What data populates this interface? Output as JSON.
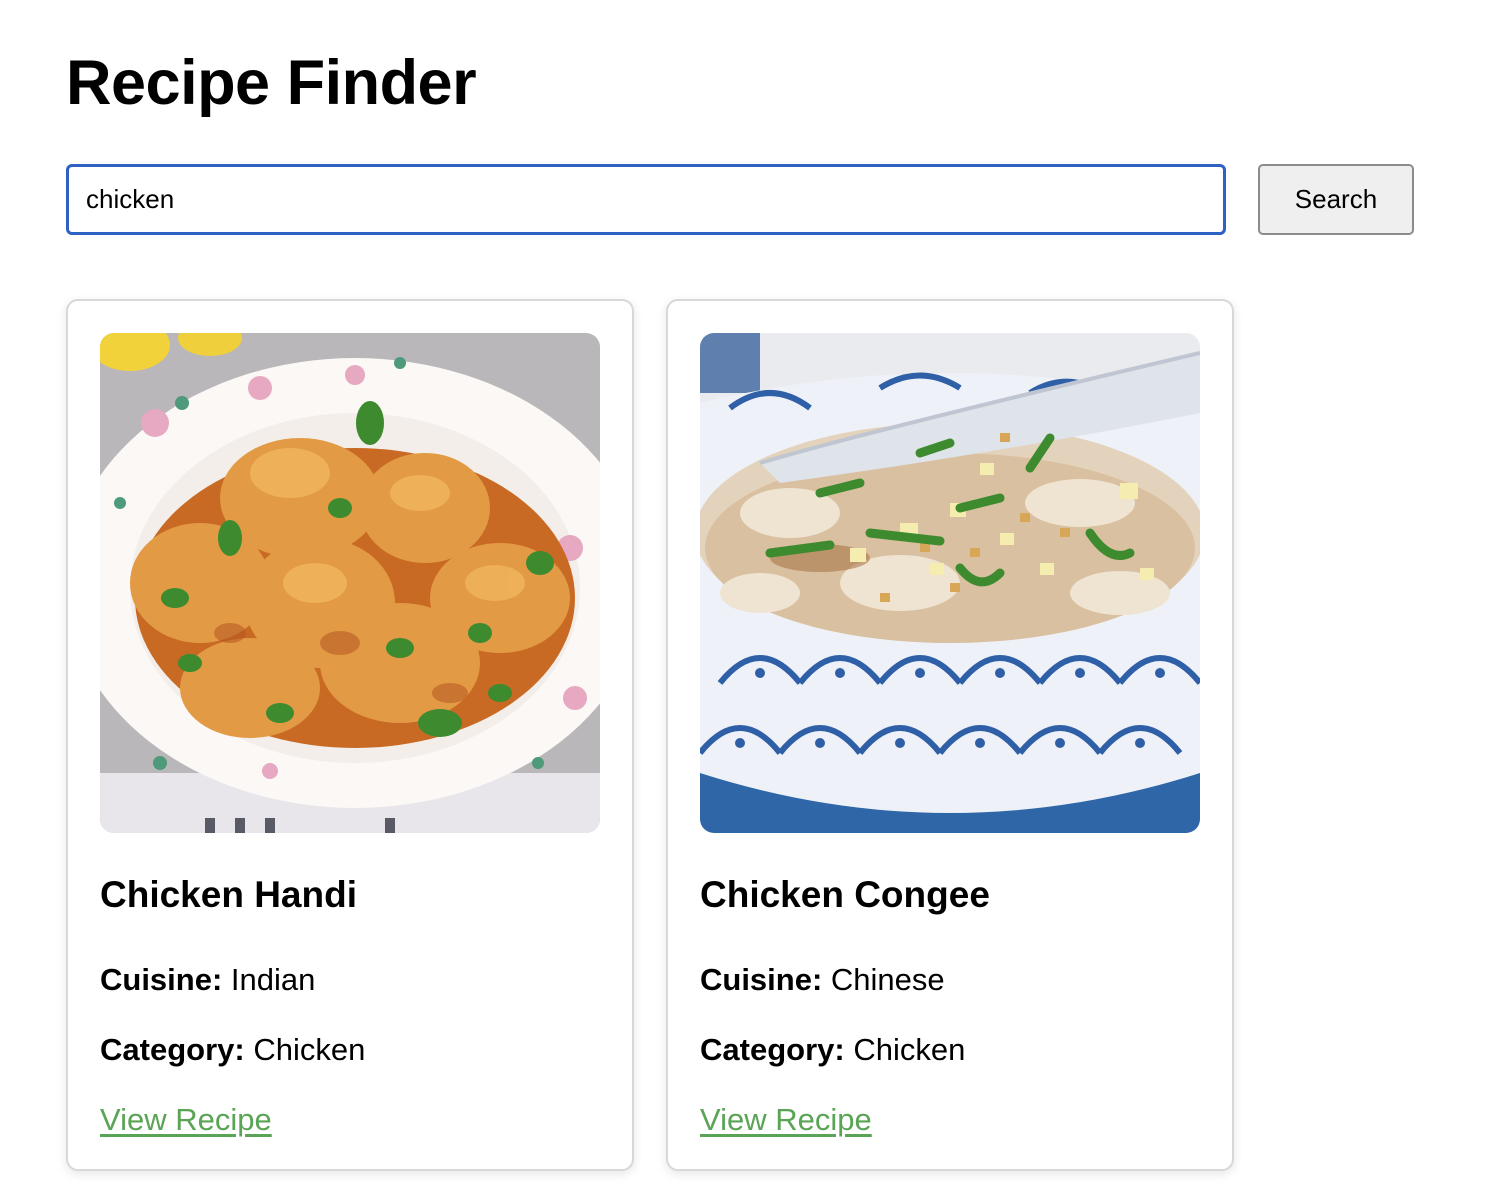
{
  "header": {
    "title": "Recipe Finder"
  },
  "search": {
    "value": "chicken",
    "button_label": "Search"
  },
  "colors": {
    "input_focus_border": "#2d62c4",
    "link": "#5aa456",
    "button_bg": "#efefef",
    "card_border": "#d8d8d8"
  },
  "results": [
    {
      "title": "Chicken Handi",
      "image": "chicken-handi-photo",
      "cuisine_label": "Cuisine:",
      "cuisine": "Indian",
      "category_label": "Category:",
      "category": "Chicken",
      "link_label": "View Recipe"
    },
    {
      "title": "Chicken Congee",
      "image": "chicken-congee-photo",
      "cuisine_label": "Cuisine:",
      "cuisine": "Chinese",
      "category_label": "Category:",
      "category": "Chicken",
      "link_label": "View Recipe"
    }
  ]
}
